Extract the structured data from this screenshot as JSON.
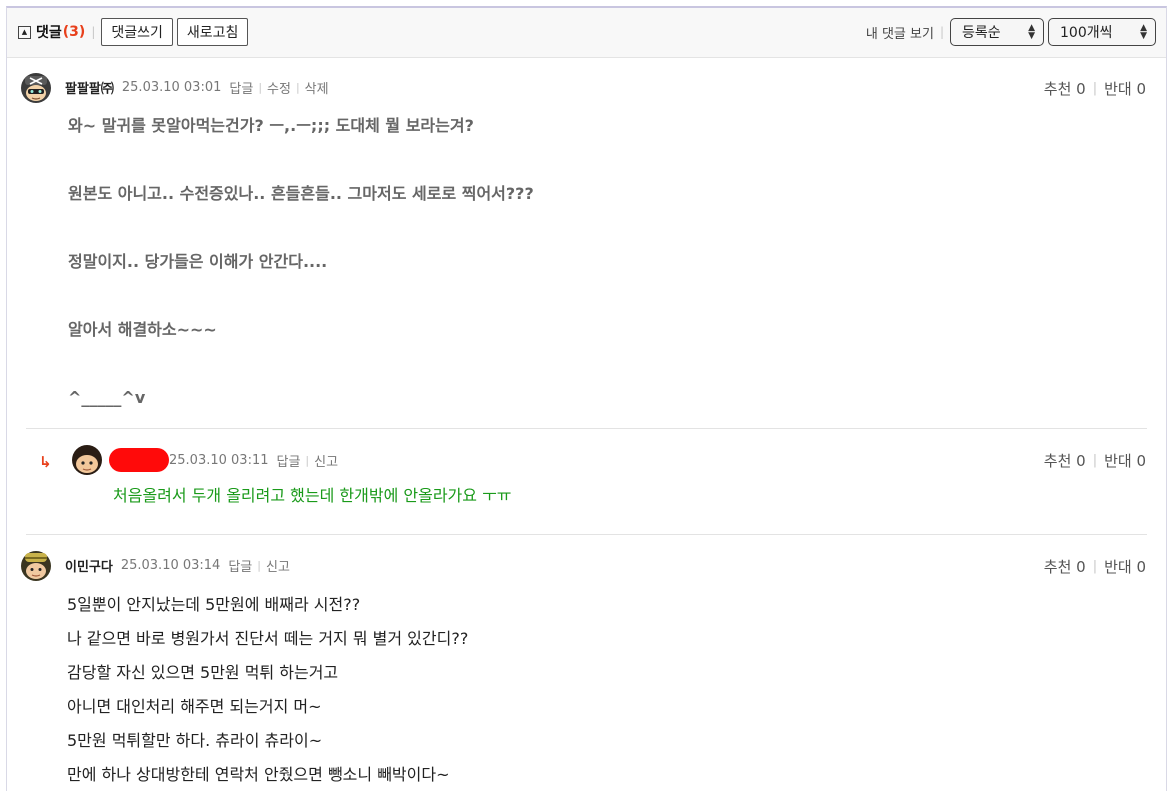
{
  "toolbar": {
    "title": "댓글",
    "count": "(3)",
    "write_label": "댓글쓰기",
    "refresh_label": "새로고침",
    "my_comments_label": "내 댓글 보기",
    "sort_value": "등록순",
    "page_size_value": "100개씩"
  },
  "comments": [
    {
      "nick": "팔팔팔㈜",
      "date": "25.03.10 03:01",
      "actions": [
        "답글",
        "수정",
        "삭제"
      ],
      "up_label": "추천 0",
      "down_label": "반대 0",
      "lines": [
        "와~ 말귀를 못알아먹는건가? ㅡ,.ㅡ;;; 도대체 뭘 보라는겨?",
        "",
        "원본도 아니고.. 수전증있나.. 흔들흔들.. 그마저도 세로로 찍어서???",
        "",
        "정말이지.. 당가들은 이해가 안간다....",
        "",
        "알아서 해결하소~~~",
        "",
        "^_____^v"
      ]
    },
    {
      "reply": true,
      "reply_icon": "reply-arrow-icon",
      "nick": "",
      "date": "25.03.10 03:11",
      "actions": [
        "답글",
        "신고"
      ],
      "up_label": "추천 0",
      "down_label": "반대 0",
      "lines": [
        "처음올려서 두개 올리려고 했는데 한개밖에 안올라가요 ㅜㅠ"
      ]
    },
    {
      "nick": "이민구다",
      "date": "25.03.10 03:14",
      "actions": [
        "답글",
        "신고"
      ],
      "up_label": "추천 0",
      "down_label": "반대 0",
      "lines": [
        "5일뿐이 안지났는데 5만원에 배째라 시전??",
        "나 같으면 바로 병원가서 진단서 떼는 거지 뭐 별거 있간디??",
        "감당할 자신 있으면 5만원 먹튀 하는거고",
        "아니면 대인처리 해주면 되는거지 머~",
        "5만원 먹튀할만 하다. 츄라이 츄라이~",
        "만에 하나 상대방한테 연락처 안줬으면 뺑소니 빼박이다~"
      ]
    }
  ],
  "colors": {
    "count": "#e8401c",
    "reply_text": "#1a9a1a",
    "redaction": "#ff0a0a"
  }
}
